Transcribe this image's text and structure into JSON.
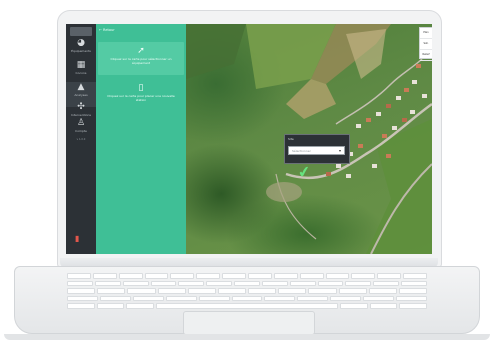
{
  "sidebar": {
    "items": [
      {
        "label": "Équipements",
        "icon": "helmet-icon"
      },
      {
        "label": "Cocons",
        "icon": "grid-icon"
      },
      {
        "label": "Analyses",
        "icon": "chart-icon"
      },
      {
        "label": "Interventions",
        "icon": "tools-icon"
      },
      {
        "label": "Compte",
        "icon": "user-icon"
      }
    ],
    "footer_text": "v 1.0.0"
  },
  "panel": {
    "header": "← Retour",
    "cards": [
      {
        "icon": "cursor-icon",
        "text": "Cliquez sur la carte pour sélectionner un équipement"
      },
      {
        "icon": "document-icon",
        "text": "Cliquez sur la carte pour placer une nouvelle station"
      }
    ]
  },
  "map": {
    "zoom_controls": [
      "Plan",
      "Sat.",
      "Relief"
    ],
    "popup": {
      "title": "Site",
      "select_placeholder": "Sélectionner",
      "select_arrow": "▾"
    }
  },
  "colors": {
    "panel_green": "#3fbf96",
    "sidebar_dark": "#2c3136",
    "pin_green": "#67e27f"
  }
}
